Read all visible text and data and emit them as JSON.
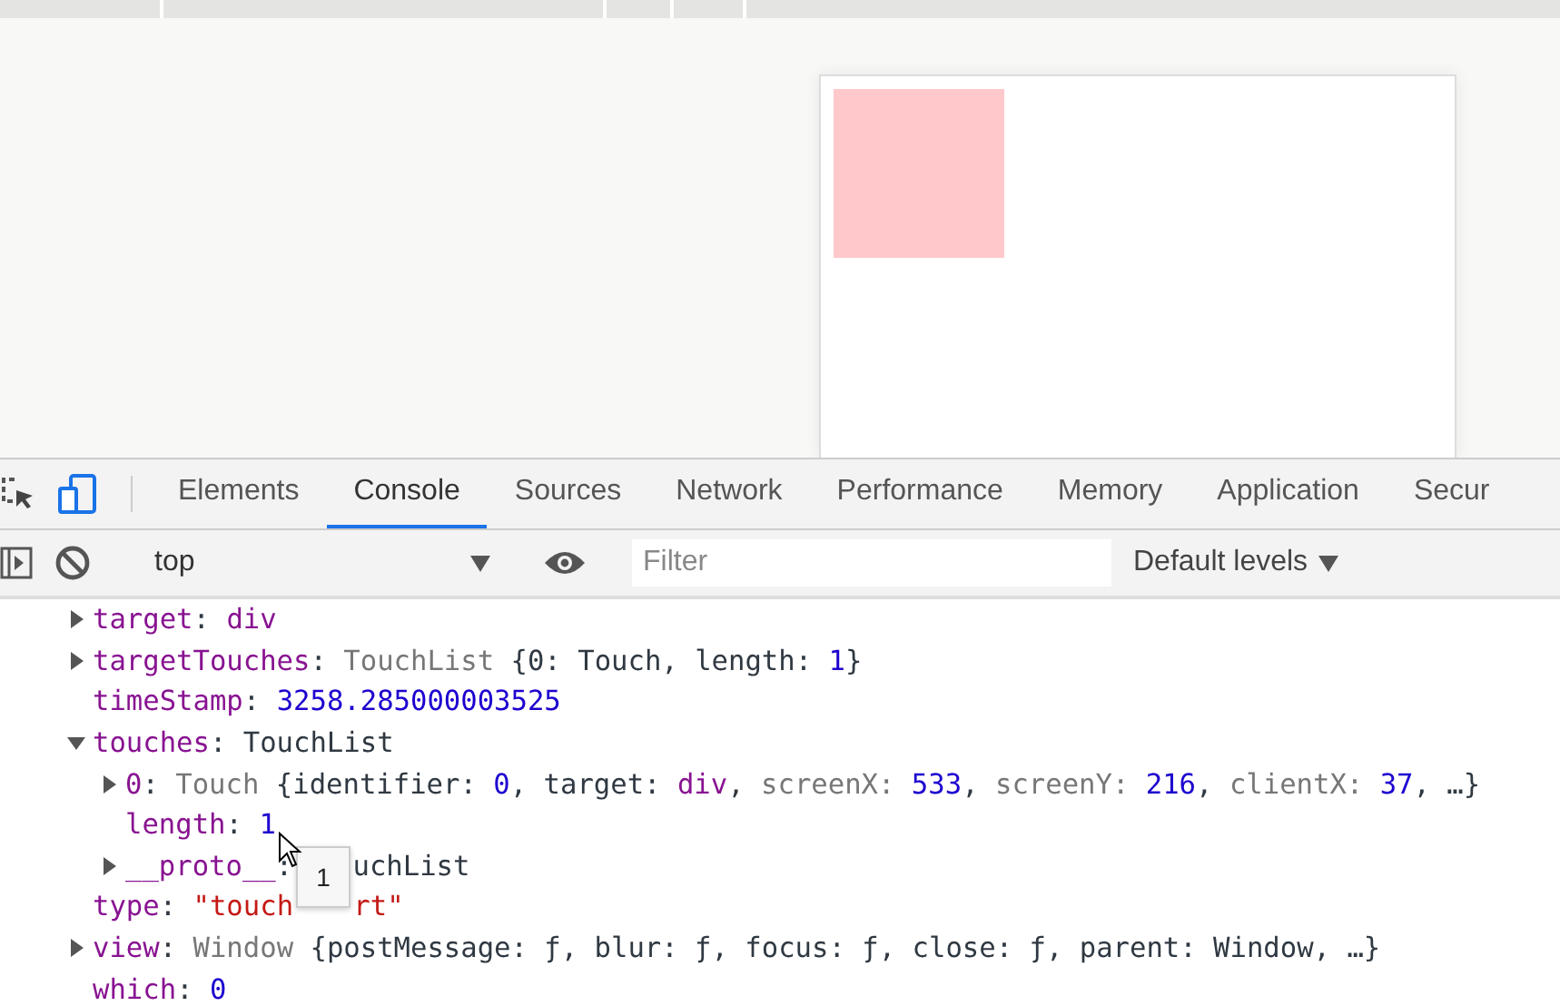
{
  "devtools": {
    "tabs": [
      {
        "label": "Elements",
        "selected": false
      },
      {
        "label": "Console",
        "selected": true
      },
      {
        "label": "Sources",
        "selected": false
      },
      {
        "label": "Network",
        "selected": false
      },
      {
        "label": "Performance",
        "selected": false
      },
      {
        "label": "Memory",
        "selected": false
      },
      {
        "label": "Application",
        "selected": false
      },
      {
        "label": "Secur",
        "selected": false
      }
    ],
    "toolbar": {
      "context": "top",
      "filter": {
        "placeholder": "Filter"
      },
      "levels": "Default levels"
    },
    "console_lines": [
      {
        "kind": "expandable",
        "expanded": false,
        "tokens": [
          {
            "kind": "key",
            "text": "target"
          },
          {
            "kind": "punct",
            "text": ": "
          },
          {
            "kind": "key",
            "text": "div"
          }
        ]
      },
      {
        "kind": "expandable",
        "expanded": false,
        "tokens": [
          {
            "kind": "key",
            "text": "targetTouches"
          },
          {
            "kind": "punct",
            "text": ": "
          },
          {
            "kind": "dim",
            "text": "TouchList "
          },
          {
            "kind": "punct",
            "text": "{0: Touch, length: "
          },
          {
            "kind": "num",
            "text": "1"
          },
          {
            "kind": "punct",
            "text": "}"
          }
        ]
      },
      {
        "kind": "leaf",
        "tokens": [
          {
            "kind": "key",
            "text": "timeStamp"
          },
          {
            "kind": "punct",
            "text": ": "
          },
          {
            "kind": "num",
            "text": "3258.285000003525"
          }
        ]
      },
      {
        "kind": "expandable",
        "expanded": true,
        "tokens": [
          {
            "kind": "key",
            "text": "touches"
          },
          {
            "kind": "punct",
            "text": ": TouchList"
          }
        ],
        "children": [
          {
            "kind": "expandable",
            "expanded": false,
            "tokens": [
              {
                "kind": "key",
                "text": "0"
              },
              {
                "kind": "punct",
                "text": ": "
              },
              {
                "kind": "dim",
                "text": "Touch "
              },
              {
                "kind": "punct",
                "text": "{identifier: "
              },
              {
                "kind": "num",
                "text": "0"
              },
              {
                "kind": "punct",
                "text": ", target: "
              },
              {
                "kind": "key",
                "text": "div"
              },
              {
                "kind": "punct",
                "text": ", "
              },
              {
                "kind": "dim",
                "text": "screenX: "
              },
              {
                "kind": "num",
                "text": "533"
              },
              {
                "kind": "punct",
                "text": ", "
              },
              {
                "kind": "dim",
                "text": "screenY: "
              },
              {
                "kind": "num",
                "text": "216"
              },
              {
                "kind": "punct",
                "text": ", "
              },
              {
                "kind": "dim",
                "text": "clientX: "
              },
              {
                "kind": "num",
                "text": "37"
              },
              {
                "kind": "punct",
                "text": ", …}"
              }
            ]
          },
          {
            "kind": "leaf",
            "tokens": [
              {
                "kind": "key",
                "text": "length"
              },
              {
                "kind": "punct",
                "text": ": "
              },
              {
                "kind": "num",
                "text": "1"
              }
            ]
          },
          {
            "kind": "expandable",
            "expanded": false,
            "tokens": [
              {
                "kind": "key",
                "text": "__proto__"
              },
              {
                "kind": "punct",
                "text": ":"
              },
              {
                "kind": "gap"
              },
              {
                "kind": "punct",
                "text": "uchList"
              }
            ]
          }
        ]
      },
      {
        "kind": "leaf",
        "tokens": [
          {
            "kind": "key",
            "text": "type"
          },
          {
            "kind": "punct",
            "text": ": "
          },
          {
            "kind": "str",
            "text": "\"touch"
          },
          {
            "kind": "gap"
          },
          {
            "kind": "str",
            "text": "rt\""
          }
        ]
      },
      {
        "kind": "expandable",
        "expanded": false,
        "tokens": [
          {
            "kind": "key",
            "text": "view"
          },
          {
            "kind": "punct",
            "text": ": "
          },
          {
            "kind": "dim",
            "text": "Window "
          },
          {
            "kind": "punct",
            "text": "{postMessage: ƒ, blur: ƒ, focus: ƒ, close: ƒ, parent: Window, …}"
          }
        ]
      },
      {
        "kind": "leaf",
        "tokens": [
          {
            "kind": "key",
            "text": "which"
          },
          {
            "kind": "punct",
            "text": ": "
          },
          {
            "kind": "num",
            "text": "0"
          }
        ]
      }
    ],
    "tooltip": "1"
  }
}
